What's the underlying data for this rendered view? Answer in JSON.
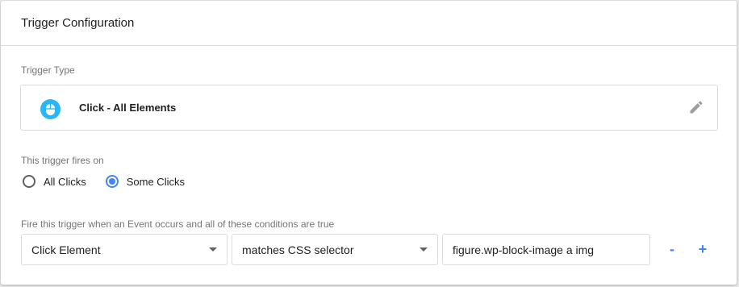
{
  "card": {
    "title": "Trigger Configuration"
  },
  "trigger_type": {
    "label": "Trigger Type",
    "name": "Click - All Elements",
    "icon": "mouse-icon",
    "icon_color": "#29b6f6"
  },
  "fires_on": {
    "label": "This trigger fires on",
    "options": [
      {
        "label": "All Clicks",
        "selected": false
      },
      {
        "label": "Some Clicks",
        "selected": true
      }
    ]
  },
  "conditions": {
    "label": "Fire this trigger when an Event occurs and all of these conditions are true",
    "variable": "Click Element",
    "operator": "matches CSS selector",
    "value": "figure.wp-block-image a img",
    "remove_label": "-",
    "add_label": "+"
  },
  "colors": {
    "accent": "#4285f4"
  }
}
